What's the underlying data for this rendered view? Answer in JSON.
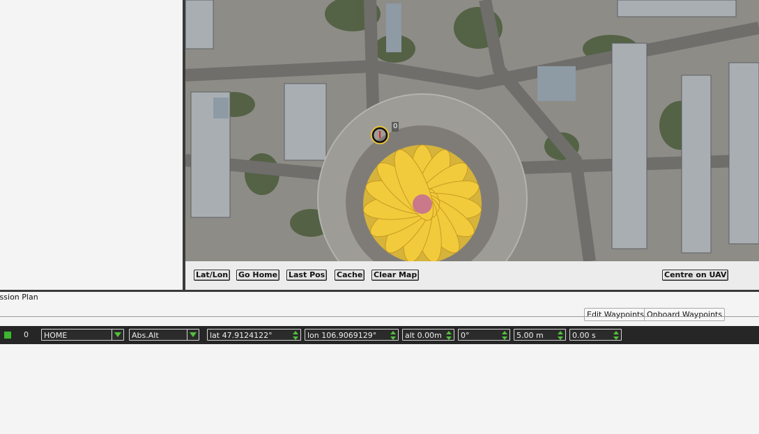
{
  "map": {
    "buttons": {
      "latlon": "Lat/Lon",
      "go_home": "Go Home",
      "last_pos": "Last Pos",
      "cache": "Cache",
      "clear_map": "Clear Map",
      "centre_uav": "Centre on UAV"
    },
    "waypoint_marker_label": "0"
  },
  "mission": {
    "tab_label": "Mission Plan",
    "edit_waypoints": "Edit Waypoints",
    "onboard_waypoints": "Onboard Waypoints"
  },
  "waypoint_row": {
    "status_color": "#3cb82f",
    "index": "0",
    "command": "HOME",
    "alt_mode": "Abs.Alt",
    "lat": "lat 47.9124122°",
    "lon": "lon 106.9069129°",
    "alt": "alt 0.00m",
    "heading": "0°",
    "radius": "5.00 m",
    "delay": "0.00 s"
  },
  "colors": {
    "toolbar_bg": "#262626",
    "accent_green": "#52c23a",
    "panel_bg": "#f4f4f4"
  }
}
